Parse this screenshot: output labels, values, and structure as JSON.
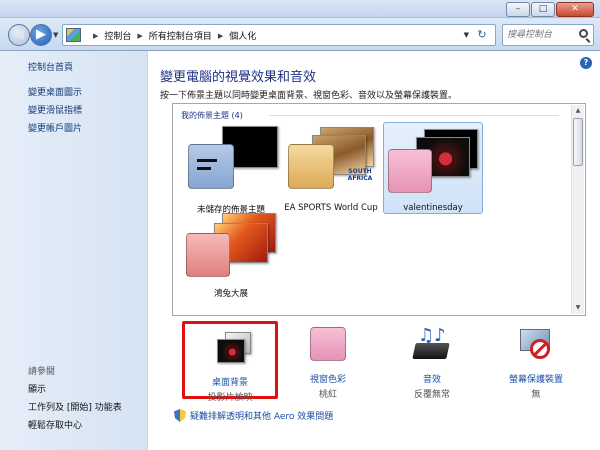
{
  "window": {
    "minimize_glyph": "–",
    "maximize_glyph": "□",
    "close_glyph": "✕"
  },
  "nav": {
    "back_glyph": "◀",
    "forward_glyph": "▶",
    "breadcrumbs": [
      "控制台",
      "所有控制台項目",
      "個人化"
    ],
    "search_placeholder": "搜尋控制台"
  },
  "sidebar": {
    "home": "控制台首頁",
    "items": [
      "變更桌面圖示",
      "變更滑鼠指標",
      "變更帳戶圖片"
    ],
    "see_also_title": "請參閱",
    "see_also": [
      "顯示",
      "工作列及 [開始] 功能表",
      "輕鬆存取中心"
    ]
  },
  "main": {
    "title": "變更電腦的視覺效果和音效",
    "description": "按一下佈景主題以同時變更桌面背景、視窗色彩、音效以及螢幕保護裝置。",
    "group_header": "我的佈景主題 (4)",
    "themes": [
      {
        "label": "未儲存的佈景主題",
        "selected": false
      },
      {
        "label": "EA SPORTS World Cup",
        "selected": false,
        "logo_text": "SOUTH AFRICA"
      },
      {
        "label": "valentinesday",
        "selected": true
      },
      {
        "label": "鴻兔大展",
        "selected": false
      }
    ],
    "settings": [
      {
        "name": "桌面背景",
        "value": "投影片放映",
        "highlighted": true
      },
      {
        "name": "視窗色彩",
        "value": "桃紅",
        "highlighted": false
      },
      {
        "name": "音效",
        "value": "反覆無常",
        "highlighted": false
      },
      {
        "name": "螢幕保護裝置",
        "value": "無",
        "highlighted": false
      }
    ],
    "aero_link": "疑難排解透明和其他 Aero 效果問題"
  },
  "colors": {
    "accent_link": "#1a4fa6",
    "title_blue": "#1e3287",
    "highlight_red": "#e01010",
    "selected_bg": "#cfe2f8"
  }
}
